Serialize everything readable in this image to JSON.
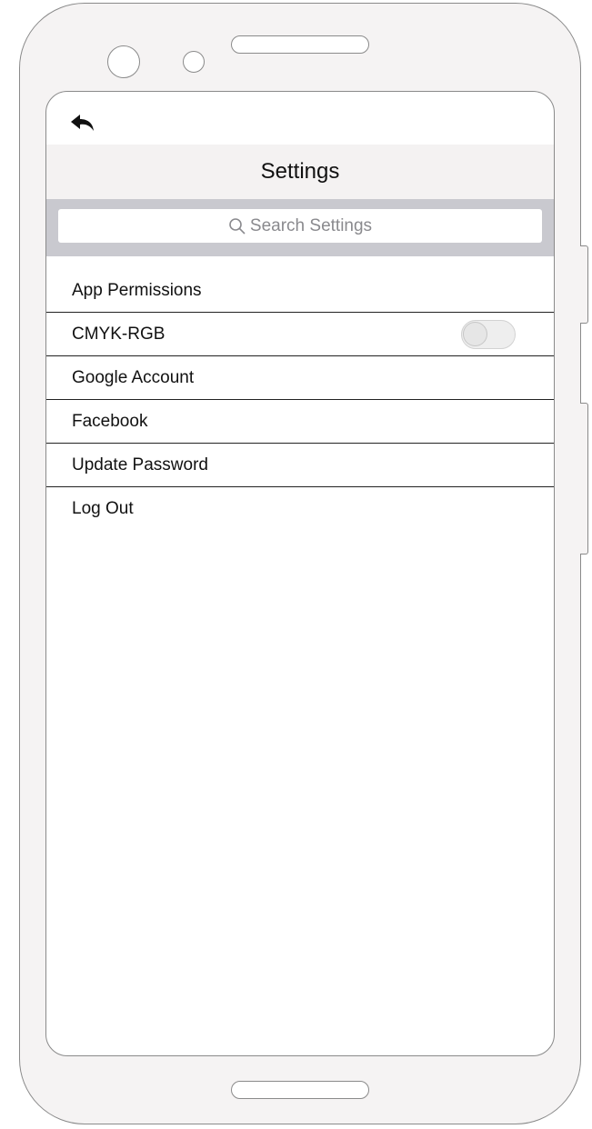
{
  "header": {
    "back_icon": "back-arrow-icon",
    "title": "Settings"
  },
  "search": {
    "icon": "search-icon",
    "placeholder": "Search Settings"
  },
  "settings": {
    "items": [
      {
        "label": "App Permissions"
      },
      {
        "label": "CMYK-RGB",
        "toggle": {
          "on": false
        }
      },
      {
        "label": "Google Account"
      },
      {
        "label": "Facebook"
      },
      {
        "label": "Update Password"
      },
      {
        "label": "Log Out"
      }
    ]
  }
}
